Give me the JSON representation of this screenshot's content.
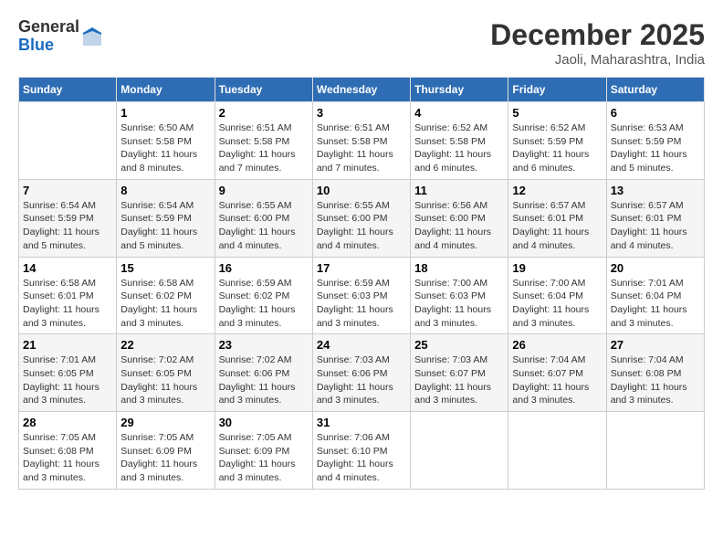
{
  "header": {
    "logo": {
      "general": "General",
      "blue": "Blue"
    },
    "month": "December 2025",
    "location": "Jaoli, Maharashtra, India"
  },
  "calendar": {
    "weekdays": [
      "Sunday",
      "Monday",
      "Tuesday",
      "Wednesday",
      "Thursday",
      "Friday",
      "Saturday"
    ],
    "weeks": [
      [
        {
          "day": null
        },
        {
          "day": "1",
          "sunrise": "Sunrise: 6:50 AM",
          "sunset": "Sunset: 5:58 PM",
          "daylight": "Daylight: 11 hours and 8 minutes."
        },
        {
          "day": "2",
          "sunrise": "Sunrise: 6:51 AM",
          "sunset": "Sunset: 5:58 PM",
          "daylight": "Daylight: 11 hours and 7 minutes."
        },
        {
          "day": "3",
          "sunrise": "Sunrise: 6:51 AM",
          "sunset": "Sunset: 5:58 PM",
          "daylight": "Daylight: 11 hours and 7 minutes."
        },
        {
          "day": "4",
          "sunrise": "Sunrise: 6:52 AM",
          "sunset": "Sunset: 5:58 PM",
          "daylight": "Daylight: 11 hours and 6 minutes."
        },
        {
          "day": "5",
          "sunrise": "Sunrise: 6:52 AM",
          "sunset": "Sunset: 5:59 PM",
          "daylight": "Daylight: 11 hours and 6 minutes."
        },
        {
          "day": "6",
          "sunrise": "Sunrise: 6:53 AM",
          "sunset": "Sunset: 5:59 PM",
          "daylight": "Daylight: 11 hours and 5 minutes."
        }
      ],
      [
        {
          "day": "7",
          "sunrise": "Sunrise: 6:54 AM",
          "sunset": "Sunset: 5:59 PM",
          "daylight": "Daylight: 11 hours and 5 minutes."
        },
        {
          "day": "8",
          "sunrise": "Sunrise: 6:54 AM",
          "sunset": "Sunset: 5:59 PM",
          "daylight": "Daylight: 11 hours and 5 minutes."
        },
        {
          "day": "9",
          "sunrise": "Sunrise: 6:55 AM",
          "sunset": "Sunset: 6:00 PM",
          "daylight": "Daylight: 11 hours and 4 minutes."
        },
        {
          "day": "10",
          "sunrise": "Sunrise: 6:55 AM",
          "sunset": "Sunset: 6:00 PM",
          "daylight": "Daylight: 11 hours and 4 minutes."
        },
        {
          "day": "11",
          "sunrise": "Sunrise: 6:56 AM",
          "sunset": "Sunset: 6:00 PM",
          "daylight": "Daylight: 11 hours and 4 minutes."
        },
        {
          "day": "12",
          "sunrise": "Sunrise: 6:57 AM",
          "sunset": "Sunset: 6:01 PM",
          "daylight": "Daylight: 11 hours and 4 minutes."
        },
        {
          "day": "13",
          "sunrise": "Sunrise: 6:57 AM",
          "sunset": "Sunset: 6:01 PM",
          "daylight": "Daylight: 11 hours and 4 minutes."
        }
      ],
      [
        {
          "day": "14",
          "sunrise": "Sunrise: 6:58 AM",
          "sunset": "Sunset: 6:01 PM",
          "daylight": "Daylight: 11 hours and 3 minutes."
        },
        {
          "day": "15",
          "sunrise": "Sunrise: 6:58 AM",
          "sunset": "Sunset: 6:02 PM",
          "daylight": "Daylight: 11 hours and 3 minutes."
        },
        {
          "day": "16",
          "sunrise": "Sunrise: 6:59 AM",
          "sunset": "Sunset: 6:02 PM",
          "daylight": "Daylight: 11 hours and 3 minutes."
        },
        {
          "day": "17",
          "sunrise": "Sunrise: 6:59 AM",
          "sunset": "Sunset: 6:03 PM",
          "daylight": "Daylight: 11 hours and 3 minutes."
        },
        {
          "day": "18",
          "sunrise": "Sunrise: 7:00 AM",
          "sunset": "Sunset: 6:03 PM",
          "daylight": "Daylight: 11 hours and 3 minutes."
        },
        {
          "day": "19",
          "sunrise": "Sunrise: 7:00 AM",
          "sunset": "Sunset: 6:04 PM",
          "daylight": "Daylight: 11 hours and 3 minutes."
        },
        {
          "day": "20",
          "sunrise": "Sunrise: 7:01 AM",
          "sunset": "Sunset: 6:04 PM",
          "daylight": "Daylight: 11 hours and 3 minutes."
        }
      ],
      [
        {
          "day": "21",
          "sunrise": "Sunrise: 7:01 AM",
          "sunset": "Sunset: 6:05 PM",
          "daylight": "Daylight: 11 hours and 3 minutes."
        },
        {
          "day": "22",
          "sunrise": "Sunrise: 7:02 AM",
          "sunset": "Sunset: 6:05 PM",
          "daylight": "Daylight: 11 hours and 3 minutes."
        },
        {
          "day": "23",
          "sunrise": "Sunrise: 7:02 AM",
          "sunset": "Sunset: 6:06 PM",
          "daylight": "Daylight: 11 hours and 3 minutes."
        },
        {
          "day": "24",
          "sunrise": "Sunrise: 7:03 AM",
          "sunset": "Sunset: 6:06 PM",
          "daylight": "Daylight: 11 hours and 3 minutes."
        },
        {
          "day": "25",
          "sunrise": "Sunrise: 7:03 AM",
          "sunset": "Sunset: 6:07 PM",
          "daylight": "Daylight: 11 hours and 3 minutes."
        },
        {
          "day": "26",
          "sunrise": "Sunrise: 7:04 AM",
          "sunset": "Sunset: 6:07 PM",
          "daylight": "Daylight: 11 hours and 3 minutes."
        },
        {
          "day": "27",
          "sunrise": "Sunrise: 7:04 AM",
          "sunset": "Sunset: 6:08 PM",
          "daylight": "Daylight: 11 hours and 3 minutes."
        }
      ],
      [
        {
          "day": "28",
          "sunrise": "Sunrise: 7:05 AM",
          "sunset": "Sunset: 6:08 PM",
          "daylight": "Daylight: 11 hours and 3 minutes."
        },
        {
          "day": "29",
          "sunrise": "Sunrise: 7:05 AM",
          "sunset": "Sunset: 6:09 PM",
          "daylight": "Daylight: 11 hours and 3 minutes."
        },
        {
          "day": "30",
          "sunrise": "Sunrise: 7:05 AM",
          "sunset": "Sunset: 6:09 PM",
          "daylight": "Daylight: 11 hours and 3 minutes."
        },
        {
          "day": "31",
          "sunrise": "Sunrise: 7:06 AM",
          "sunset": "Sunset: 6:10 PM",
          "daylight": "Daylight: 11 hours and 4 minutes."
        },
        {
          "day": null
        },
        {
          "day": null
        },
        {
          "day": null
        }
      ]
    ]
  }
}
